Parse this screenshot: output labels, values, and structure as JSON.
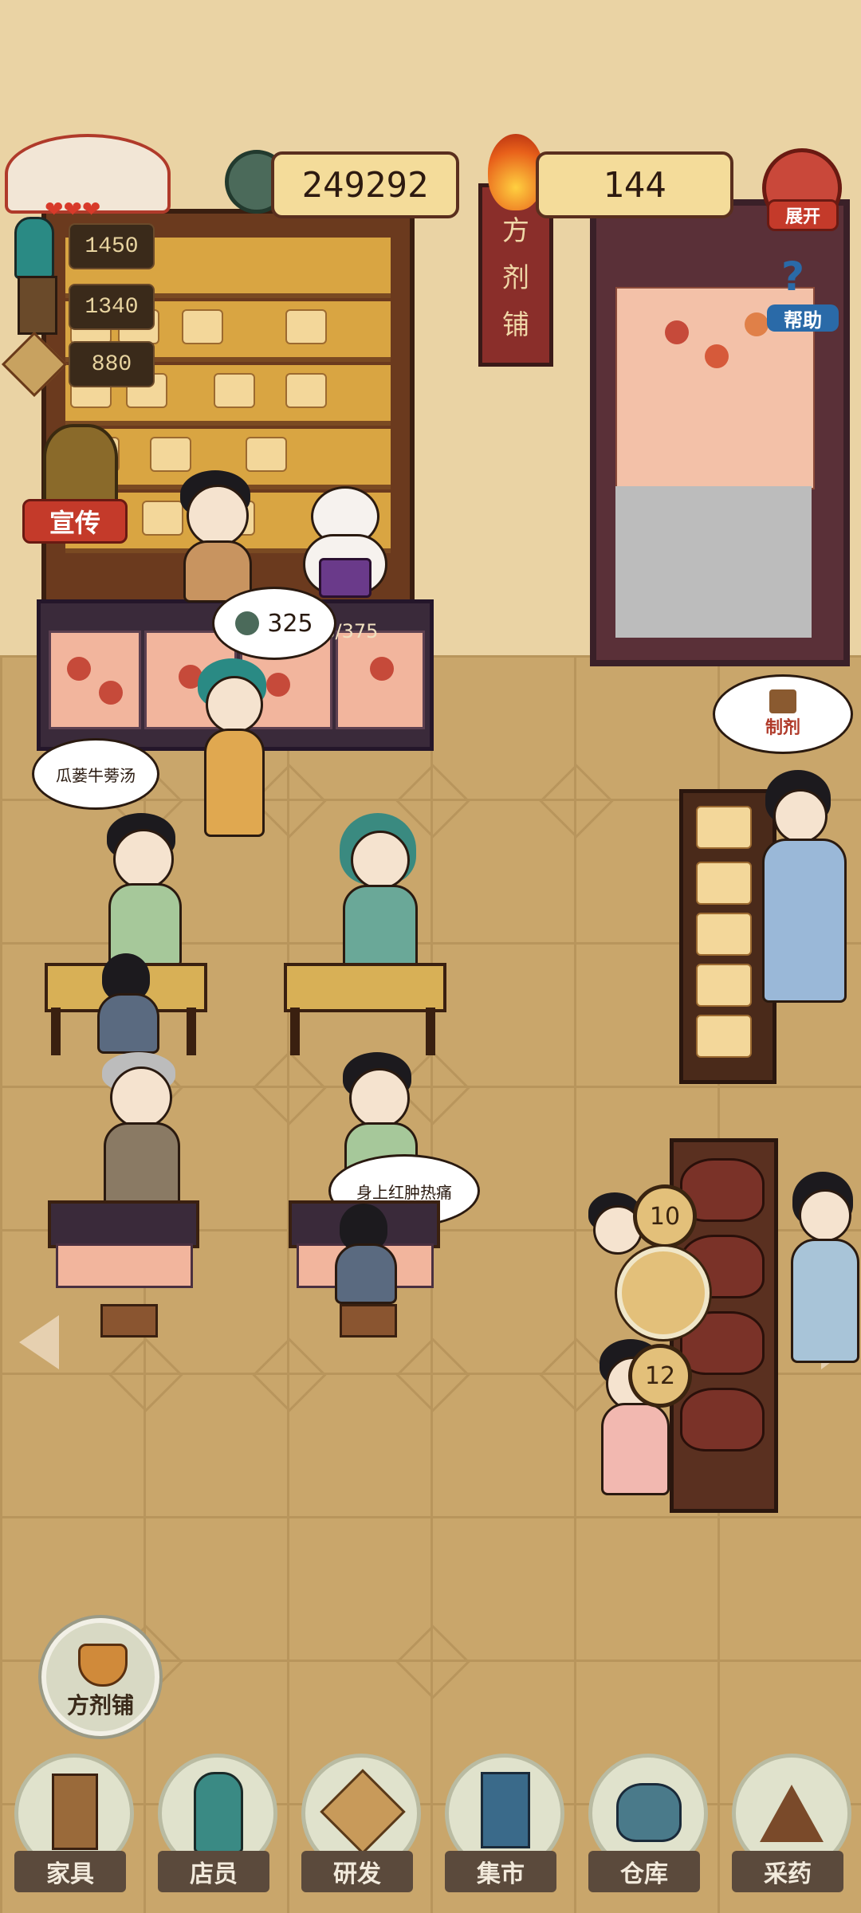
{
  "hud": {
    "coins": "249292",
    "fire": "144",
    "expand_label": "展开",
    "help_label": "帮助",
    "promote_label": "宣传",
    "shop_sign": [
      "方",
      "剂",
      "铺"
    ],
    "stats": [
      "1450",
      "1340",
      "880"
    ]
  },
  "counter": {
    "earning_bubble": "325",
    "capacity": "38/375"
  },
  "bubbles": {
    "customer_order": "瓜蒌牛蒡汤",
    "symptom": "身上红肿热痛",
    "prepare": "制剂"
  },
  "brew": {
    "timer_top": "10",
    "timer_bottom": "12"
  },
  "shop_button": "方剂铺",
  "nav": [
    {
      "label": "家具",
      "icon": "chair-icon"
    },
    {
      "label": "店员",
      "icon": "staff-icon"
    },
    {
      "label": "研发",
      "icon": "research-icon"
    },
    {
      "label": "集市",
      "icon": "market-icon"
    },
    {
      "label": "仓库",
      "icon": "warehouse-icon"
    },
    {
      "label": "采药",
      "icon": "mountain-icon"
    }
  ],
  "colors": {
    "wall": "#ead3a4",
    "floor": "#c9a66b",
    "wood": "#5a3020",
    "accent": "#c43a2a"
  }
}
